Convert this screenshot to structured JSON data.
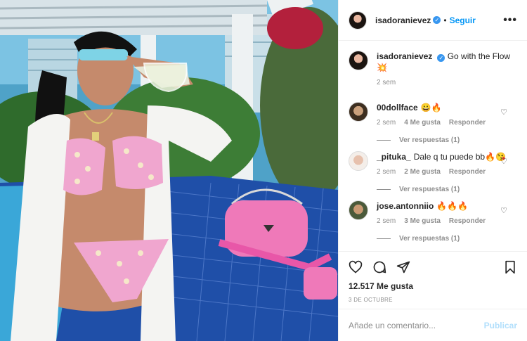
{
  "post": {
    "author": "isadoranievez",
    "follow_label": "Seguir",
    "dot": "•",
    "more": "•••"
  },
  "caption": {
    "author": "isadoranievez",
    "text": "Go with the Flow 💥",
    "time": "2 sem"
  },
  "comments": [
    {
      "author": "00dollface",
      "text": "😀🔥",
      "time": "2 sem",
      "likes": "4 Me gusta",
      "reply": "Responder",
      "view_replies": "Ver respuestas (1)"
    },
    {
      "author": "_pituka_",
      "text": "Dale q tu puede bb🔥😘",
      "time": "2 sem",
      "likes": "2 Me gusta",
      "reply": "Responder",
      "view_replies": "Ver respuestas (1)"
    },
    {
      "author": "jose.antonniio",
      "text": "🔥🔥🔥",
      "time": "2 sem",
      "likes": "3 Me gusta",
      "reply": "Responder",
      "view_replies": "Ver respuestas (1)"
    }
  ],
  "stats": {
    "likes": "12.517 Me gusta",
    "date": "3 DE OCTUBRE"
  },
  "comment_box": {
    "placeholder": "Añade un comentario...",
    "publish": "Publicar"
  },
  "colors": {
    "link": "#0095f6",
    "muted": "#8e8e8e",
    "pool": "#2a7fb0",
    "bikini": "#f0a6cf",
    "bag": "#ef79b9"
  }
}
